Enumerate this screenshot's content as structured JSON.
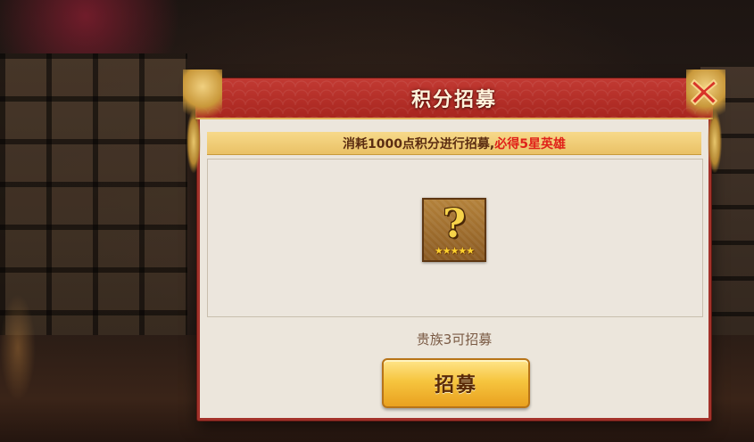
{
  "dialog": {
    "title": "积分招募",
    "banner_text": "消耗1000点积分进行招募,",
    "banner_highlight": "必得5星英雄",
    "reward": {
      "icon": "question-mark-icon",
      "symbol": "?",
      "stars": "★★★★★",
      "star_count": 5
    },
    "status_text": "贵族3可招募",
    "recruit_label": "招募",
    "close_icon": "close-icon"
  },
  "colors": {
    "header_red": "#a8261f",
    "banner_gold": "#e9c064",
    "highlight_red": "#e0221a",
    "button_gold": "#f6c53f"
  }
}
